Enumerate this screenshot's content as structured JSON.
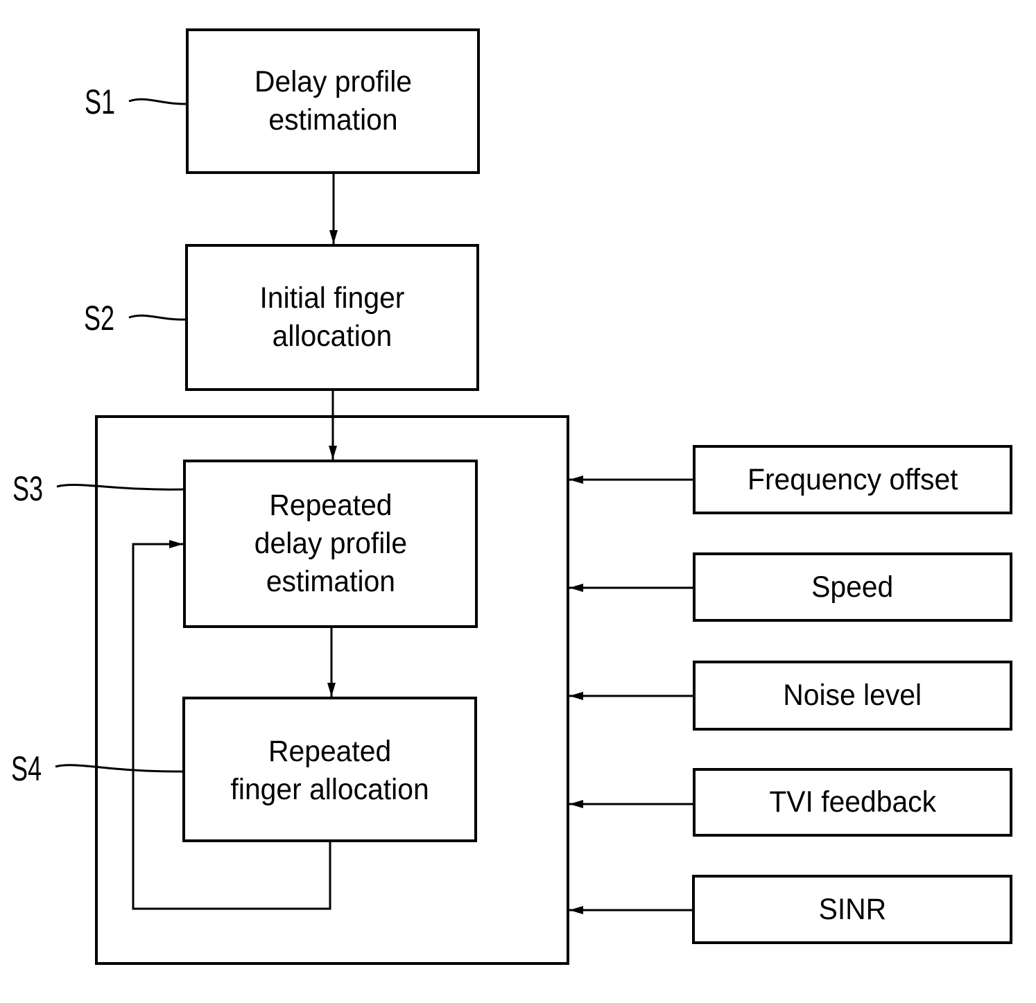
{
  "steps": [
    {
      "ref": "S1",
      "label_lines": [
        "Delay profile",
        "estimation"
      ]
    },
    {
      "ref": "S2",
      "label_lines": [
        "Initial finger",
        "allocation"
      ]
    },
    {
      "ref": "S3",
      "label_lines": [
        "Repeated",
        "delay profile",
        "estimation"
      ]
    },
    {
      "ref": "S4",
      "label_lines": [
        "Repeated",
        "finger allocation"
      ]
    }
  ],
  "inputs": [
    {
      "label": "Frequency offset"
    },
    {
      "label": "Speed"
    },
    {
      "label": "Noise level"
    },
    {
      "label": "TVI feedback"
    },
    {
      "label": "SINR"
    }
  ],
  "colors": {
    "line": "#000000",
    "background": "#ffffff"
  }
}
